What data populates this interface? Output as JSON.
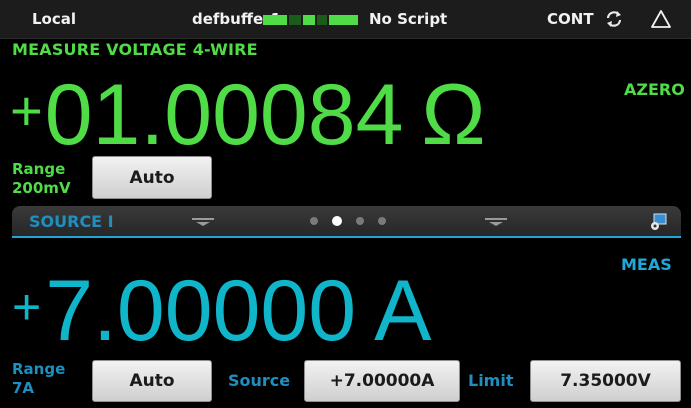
{
  "status_bar": {
    "remote": "Local",
    "buffer": "defbuffer1",
    "buffer_fill": 0.65,
    "script": "No Script",
    "trigger_mode": "CONT",
    "icons": [
      "refresh-icon",
      "alarm-icon"
    ]
  },
  "measure": {
    "function": "MEASURE VOLTAGE 4-WIRE",
    "sign": "+",
    "value": "01.00084",
    "unit": "Ω",
    "azero": "AZERO",
    "range_label_line1": "Range",
    "range_label_line2": "200mV",
    "range_button": "Auto"
  },
  "swipe": {
    "title": "SOURCE I",
    "pages": 4,
    "active_page": 2
  },
  "source": {
    "meas_label": "MEAS",
    "sign": "+",
    "value": "7.00000",
    "unit": "A",
    "range_label_line1": "Range",
    "range_label_line2": "7A",
    "range_button": "Auto",
    "source_label": "Source",
    "source_value": "+7.00000A",
    "limit_label": "Limit",
    "limit_value": "7.35000V"
  },
  "colors": {
    "measure_green": "#4fdc47",
    "source_cyan": "#10b5c9",
    "label_blue": "#1f8fbf",
    "background": "#000000",
    "status_bar": "#1c1c1c"
  }
}
